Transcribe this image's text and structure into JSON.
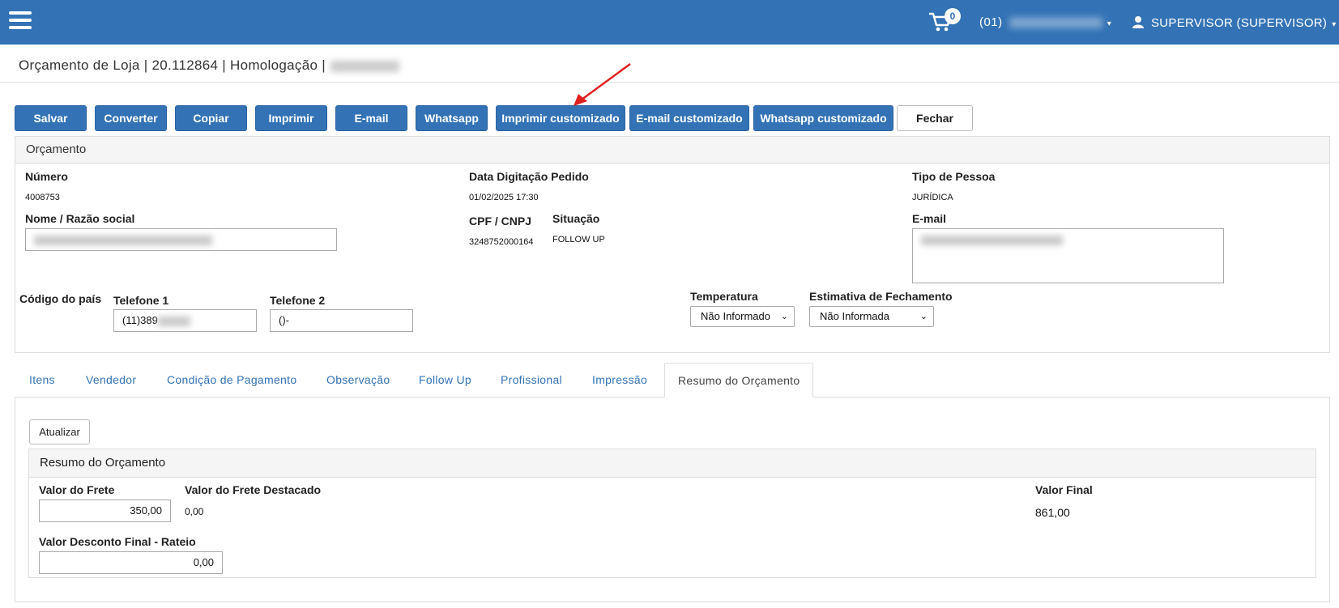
{
  "header": {
    "cart_count": "0",
    "company_prefix": "(01)",
    "user_label": "SUPERVISOR (SUPERVISOR)"
  },
  "page": {
    "title": "Orçamento de Loja | 20.112864 | Homologação |"
  },
  "toolbar": {
    "buttons": [
      "Salvar",
      "Converter",
      "Copiar",
      "Imprimir",
      "E-mail",
      "Whatsapp",
      "Imprimir customizado",
      "E-mail customizado",
      "Whatsapp customizado",
      "Fechar"
    ]
  },
  "orcamento": {
    "panel_title": "Orçamento",
    "numero_label": "Número",
    "numero_value": "4008753",
    "data_label": "Data Digitação Pedido",
    "data_value": "01/02/2025 17:30",
    "tipo_label": "Tipo de Pessoa",
    "tipo_value": "JURÍDICA",
    "nome_label": "Nome / Razão social",
    "cpf_label": "CPF / CNPJ",
    "cpf_value": "3248752000164",
    "situacao_label": "Situação",
    "situacao_value": "FOLLOW UP",
    "email_label": "E-mail",
    "codigo_pais_label": "Código do país",
    "telefone1_label": "Telefone 1",
    "telefone1_value": "(11)389",
    "telefone2_label": "Telefone 2",
    "telefone2_value": "()-",
    "temperatura_label": "Temperatura",
    "temperatura_value": "Não Informado",
    "estimativa_label": "Estimativa de Fechamento",
    "estimativa_value": "Não Informada"
  },
  "tabs": [
    "Itens",
    "Vendedor",
    "Condição de Pagamento",
    "Observação",
    "Follow Up",
    "Profissional",
    "Impressão",
    "Resumo do Orçamento"
  ],
  "resumo": {
    "atualizar_label": "Atualizar",
    "panel_title": "Resumo do Orçamento",
    "frete_label": "Valor do Frete",
    "frete_value": "350,00",
    "frete_destacado_label": "Valor do Frete Destacado",
    "frete_destacado_value": "0,00",
    "valor_final_label": "Valor Final",
    "valor_final_value": "861,00",
    "desconto_label": "Valor Desconto Final - Rateio",
    "desconto_value": "0,00"
  },
  "colors": {
    "primary": "#3373b5",
    "annotation_arrow": "#e02020"
  }
}
